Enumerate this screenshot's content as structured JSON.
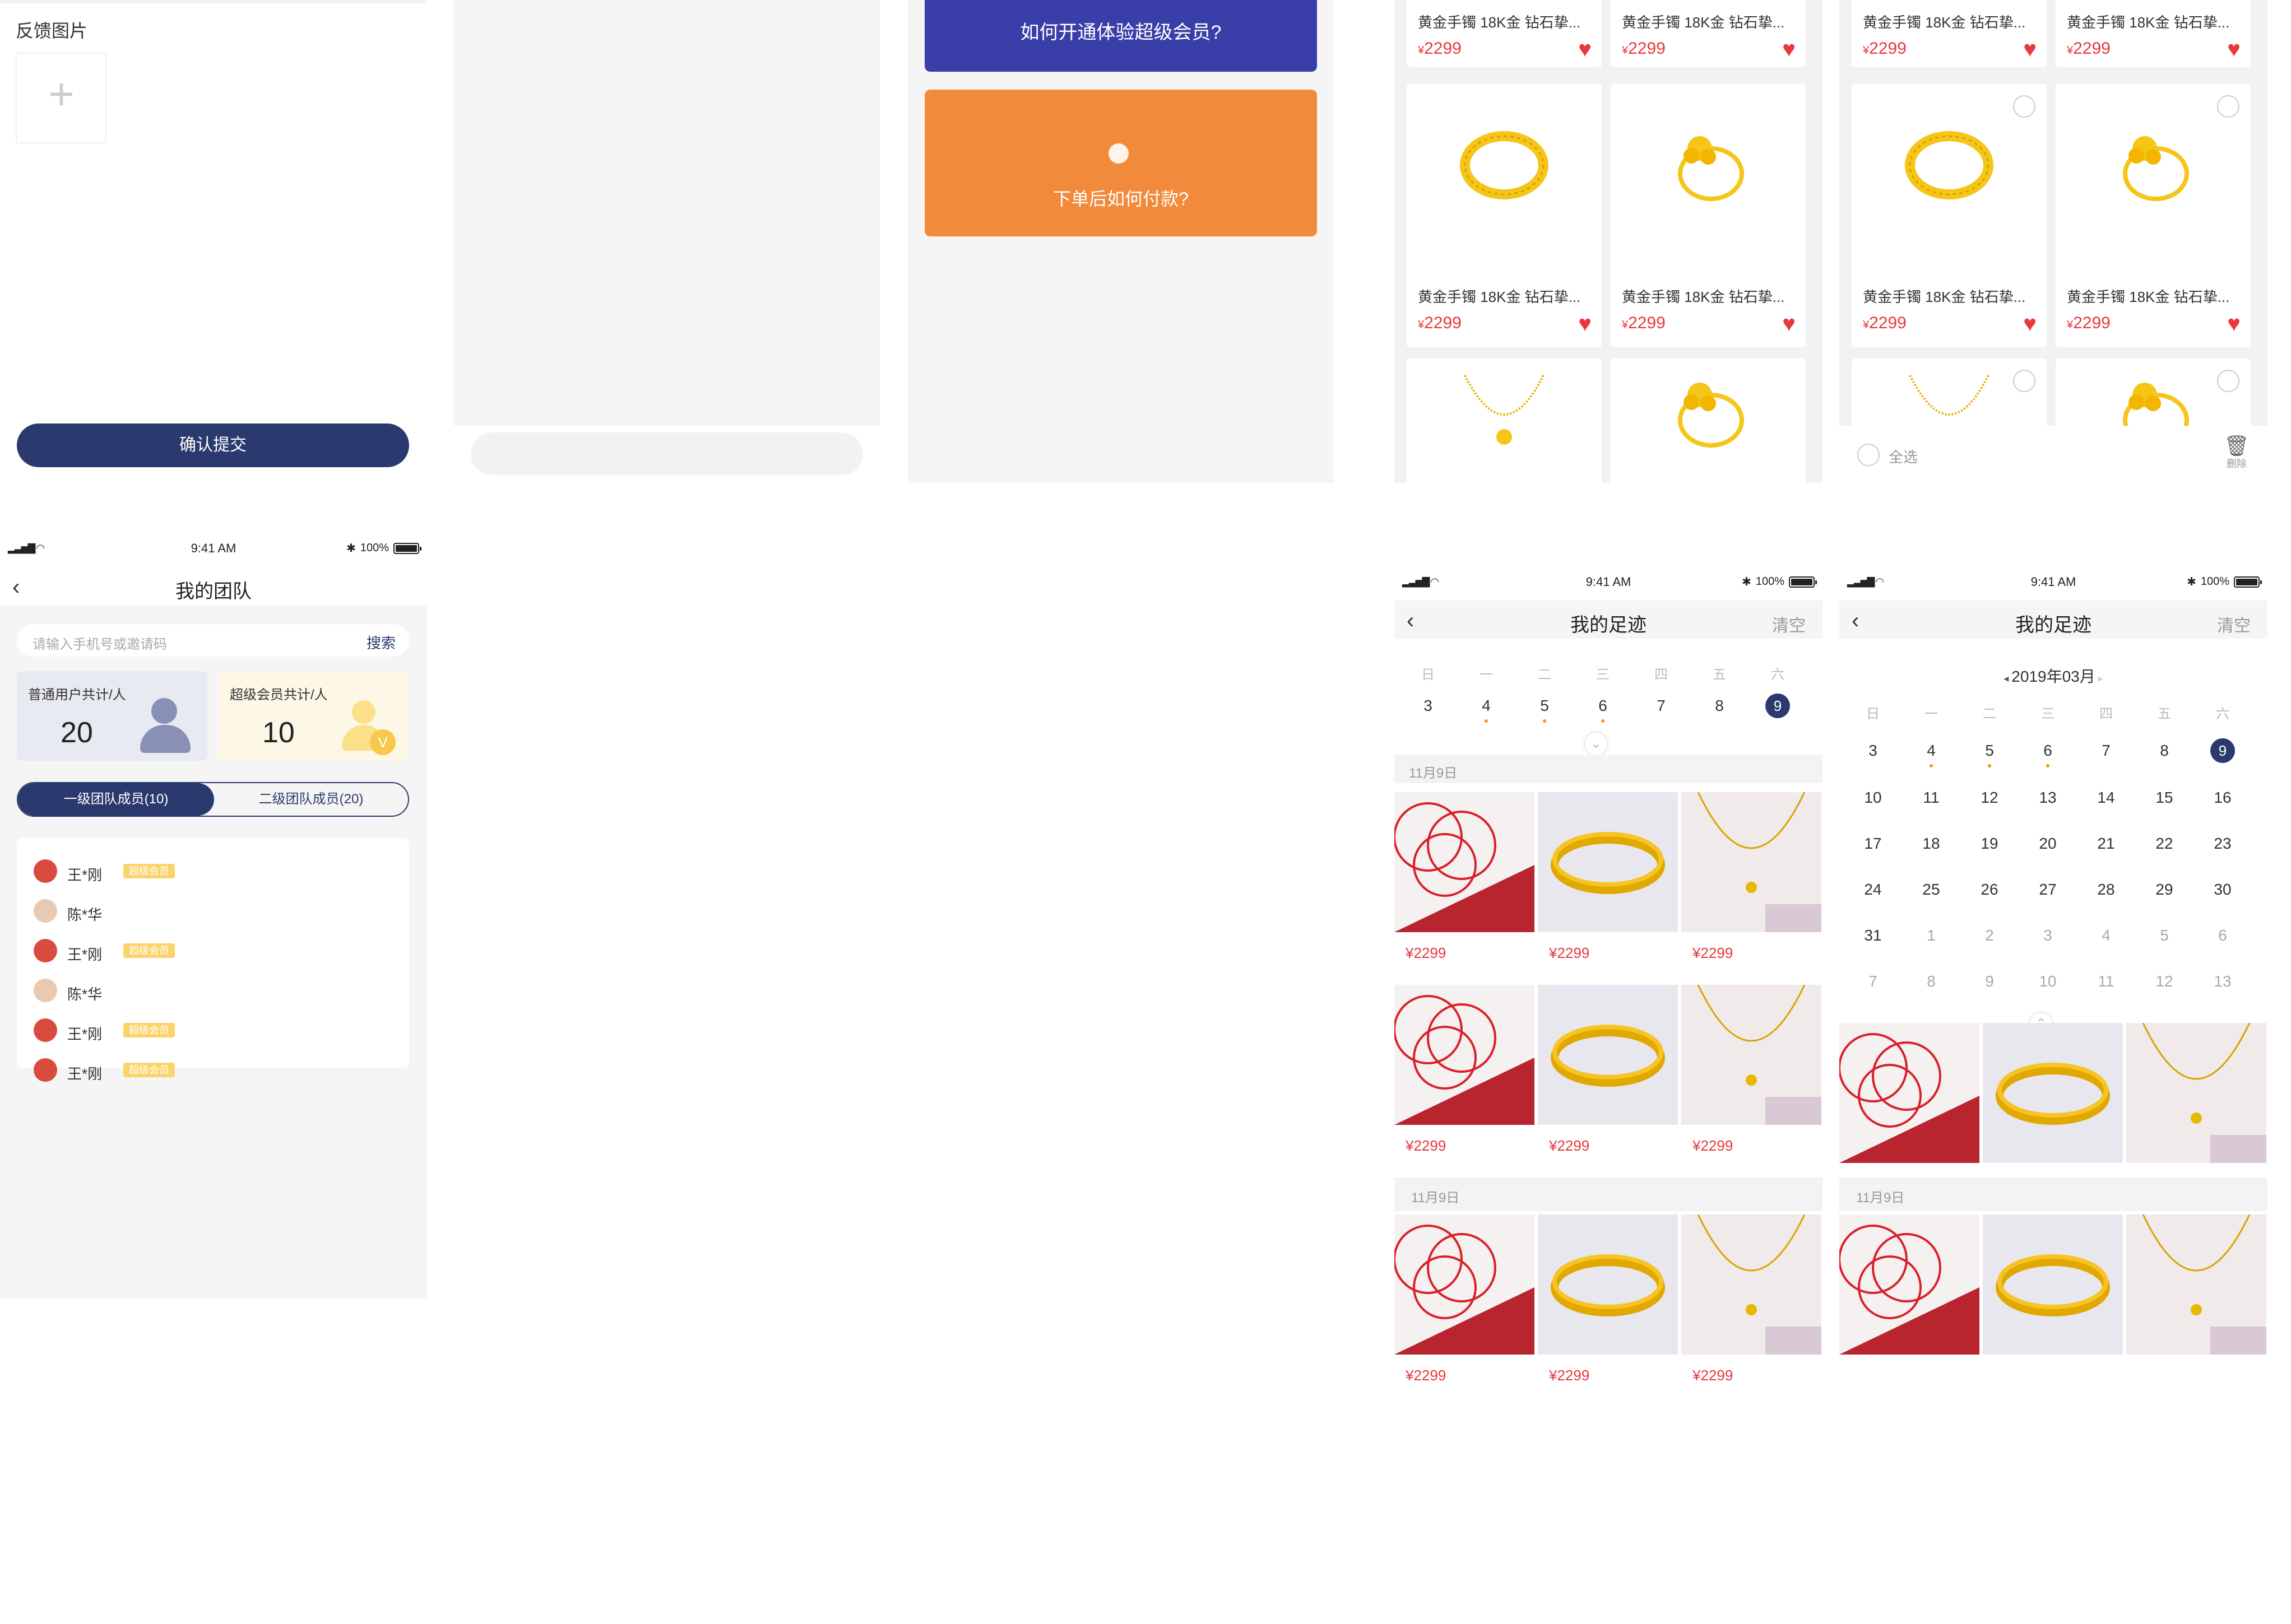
{
  "feedback": {
    "image_label": "反馈图片",
    "add_icon": "plus-icon",
    "submit_label": "确认提交"
  },
  "faq": {
    "item1": "如何开通体验超级会员?",
    "item2": "下单后如何付款?"
  },
  "favorites": {
    "product_name": "黄金手镯 18K金 钻石挚...",
    "price": "2299",
    "currency": "¥",
    "select_all": "全选",
    "delete": "删除"
  },
  "team": {
    "status": {
      "time": "9:41 AM",
      "battery": "100%"
    },
    "title": "我的团队",
    "search_placeholder": "请输入手机号或邀请码",
    "search_button": "搜索",
    "normal_label": "普通用户共计/人",
    "normal_count": "20",
    "super_label": "超级会员共计/人",
    "super_count": "10",
    "tab_level1": "一级团队成员(10)",
    "tab_level2": "二级团队成员(20)",
    "members": [
      {
        "name": "王*刚",
        "badge": "超级会员"
      },
      {
        "name": "陈*华",
        "badge": ""
      },
      {
        "name": "王*刚",
        "badge": "超级会员"
      },
      {
        "name": "陈*华",
        "badge": ""
      },
      {
        "name": "王*刚",
        "badge": "超级会员"
      },
      {
        "name": "王*刚",
        "badge": "超级会员"
      }
    ]
  },
  "footprint": {
    "status": {
      "time": "9:41 AM",
      "battery": "100%"
    },
    "title": "我的足迹",
    "clear": "清空",
    "weekdays": [
      "日",
      "一",
      "二",
      "三",
      "四",
      "五",
      "六"
    ],
    "week_days": [
      "3",
      "4",
      "5",
      "6",
      "7",
      "8",
      "9"
    ],
    "date_header": "11月9日",
    "price": "¥2299",
    "month": "2019年03月",
    "calendar_rows": [
      [
        "3",
        "4",
        "5",
        "6",
        "7",
        "8",
        "9"
      ],
      [
        "10",
        "11",
        "12",
        "13",
        "14",
        "15",
        "16"
      ],
      [
        "17",
        "18",
        "19",
        "20",
        "21",
        "22",
        "23"
      ],
      [
        "24",
        "25",
        "26",
        "27",
        "28",
        "29",
        "30"
      ],
      [
        "31",
        "1",
        "2",
        "3",
        "4",
        "5",
        "6"
      ],
      [
        "7",
        "8",
        "9",
        "10",
        "11",
        "12",
        "13"
      ]
    ]
  },
  "colors": {
    "navy": "#2b3a6e",
    "price_red": "#e8383d",
    "orange": "#f28a3c",
    "badge_yellow": "#fcd36b"
  }
}
